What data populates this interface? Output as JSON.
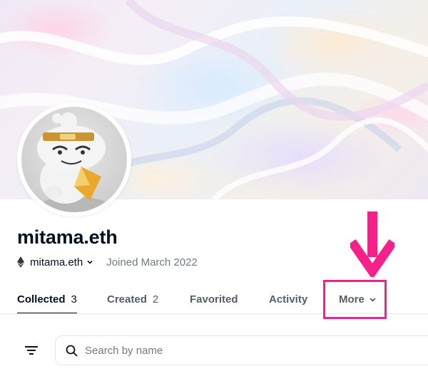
{
  "profile": {
    "name": "mitama.eth",
    "wallet": "mitama.eth",
    "joined": "Joined March 2022"
  },
  "tabs": [
    {
      "label": "Collected",
      "count": "3",
      "active": true
    },
    {
      "label": "Created",
      "count": "2",
      "active": false
    },
    {
      "label": "Favorited",
      "count": "",
      "active": false
    },
    {
      "label": "Activity",
      "count": "",
      "active": false
    },
    {
      "label": "More",
      "count": "",
      "active": false
    }
  ],
  "search": {
    "placeholder": "Search by name"
  },
  "icons": {
    "wallet_chain": "ethereum-icon",
    "wallet_menu": "chevron-down-icon",
    "more_menu": "chevron-down-icon",
    "filter": "filter-lines-icon",
    "search": "search-icon",
    "annotation": "down-arrow-icon"
  },
  "colors": {
    "text": "#04111d",
    "muted": "#707a83",
    "highlight": "#f7208b",
    "divider": "#e5e8eb"
  }
}
